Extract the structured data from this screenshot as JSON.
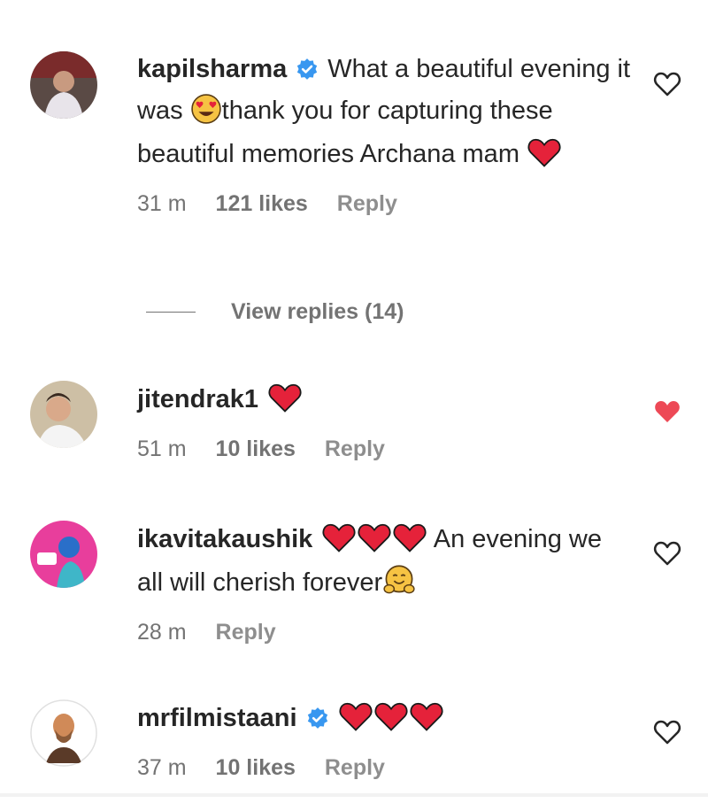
{
  "comments": [
    {
      "username": "kapilsharma",
      "verified": true,
      "text_parts": [
        "What a beautiful evening it was ",
        "thank you for capturing these beautiful memories Archana mam "
      ],
      "time": "31 m",
      "likes": "121 likes",
      "reply_label": "Reply",
      "liked": false,
      "view_replies": "View replies (14)"
    },
    {
      "username": "jitendrak1",
      "verified": false,
      "time": "51 m",
      "likes": "10 likes",
      "reply_label": "Reply",
      "liked": true
    },
    {
      "username": "ikavitakaushik",
      "verified": false,
      "text_parts": [
        " An evening we all will cherish forever"
      ],
      "time": "28 m",
      "reply_label": "Reply",
      "liked": false
    },
    {
      "username": "mrfilmistaani",
      "verified": true,
      "time": "37 m",
      "likes": "10 likes",
      "reply_label": "Reply",
      "liked": false
    }
  ],
  "icons": {
    "verified": "verified-badge-icon",
    "heart_emoji": "red-heart-emoji",
    "heart_eyes_emoji": "heart-eyes-emoji",
    "hug_emoji": "hugging-face-emoji",
    "like_outline": "heart-outline-icon",
    "like_filled": "heart-filled-icon"
  },
  "colors": {
    "verified_blue": "#3897f0",
    "liked_red": "#ed4956",
    "meta_gray": "#737373"
  }
}
